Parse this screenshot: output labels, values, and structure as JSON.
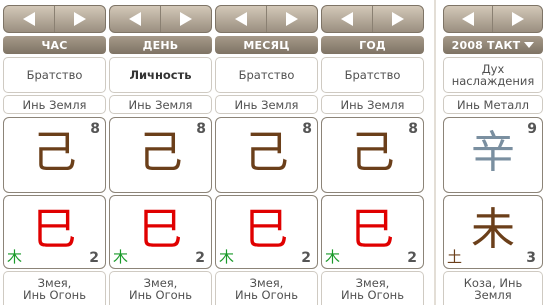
{
  "columns": [
    {
      "header": "ЧАС",
      "name": "Братство",
      "name_bold": false,
      "stem_label": "Инь Земля",
      "stem_char": "己",
      "stem_num": "8",
      "stem_color": "#6b3f1a",
      "branch_char": "巳",
      "branch_num": "2",
      "branch_color": "#e00000",
      "branch_elem": "木",
      "branch_elem_color": "#1a9a2a",
      "branch_label": "Змея,\nИнь Огонь"
    },
    {
      "header": "ДЕНЬ",
      "name": "Личность",
      "name_bold": true,
      "stem_label": "Инь Земля",
      "stem_char": "己",
      "stem_num": "8",
      "stem_color": "#6b3f1a",
      "branch_char": "巳",
      "branch_num": "2",
      "branch_color": "#e00000",
      "branch_elem": "木",
      "branch_elem_color": "#1a9a2a",
      "branch_label": "Змея,\nИнь Огонь"
    },
    {
      "header": "МЕСЯЦ",
      "name": "Братство",
      "name_bold": false,
      "stem_label": "Инь Земля",
      "stem_char": "己",
      "stem_num": "8",
      "stem_color": "#6b3f1a",
      "branch_char": "巳",
      "branch_num": "2",
      "branch_color": "#e00000",
      "branch_elem": "木",
      "branch_elem_color": "#1a9a2a",
      "branch_label": "Змея,\nИнь Огонь"
    },
    {
      "header": "ГОД",
      "name": "Братство",
      "name_bold": false,
      "stem_label": "Инь Земля",
      "stem_char": "己",
      "stem_num": "8",
      "stem_color": "#6b3f1a",
      "branch_char": "巳",
      "branch_num": "2",
      "branch_color": "#e00000",
      "branch_elem": "木",
      "branch_elem_color": "#1a9a2a",
      "branch_label": "Змея,\nИнь Огонь"
    }
  ],
  "luck": {
    "header": "2008 ТАКТ",
    "name": "Дух\nнаслаждения",
    "stem_label": "Инь Металл",
    "stem_char": "辛",
    "stem_num": "9",
    "stem_color": "#7a8fa0",
    "branch_char": "未",
    "branch_num": "3",
    "branch_color": "#6b3f1a",
    "branch_elem": "土",
    "branch_elem_color": "#6b3f1a",
    "branch_label": "Коза, Инь\nЗемля"
  },
  "icons": {
    "prev": "left-arrow-icon",
    "next": "right-arrow-icon",
    "dropdown": "dropdown-triangle-icon"
  }
}
